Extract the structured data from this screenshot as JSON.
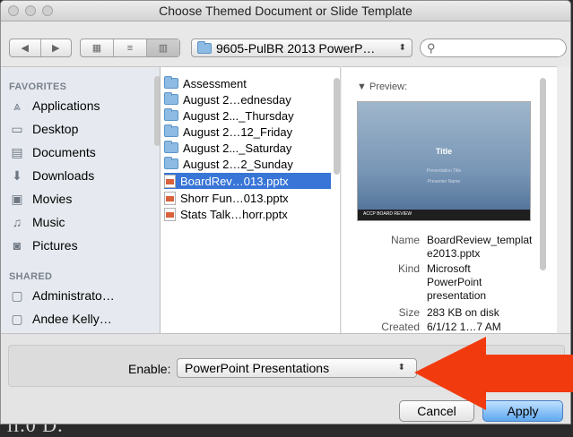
{
  "window": {
    "title": "Choose Themed Document or Slide Template"
  },
  "toolbar": {
    "back": "◀",
    "forward": "▶",
    "path": "9605-PulBR 2013 PowerP…",
    "search_placeholder": ""
  },
  "sidebar": {
    "favorites_header": "FAVORITES",
    "favorites": [
      {
        "label": "Applications",
        "icon": "applications-icon"
      },
      {
        "label": "Desktop",
        "icon": "desktop-icon"
      },
      {
        "label": "Documents",
        "icon": "documents-icon"
      },
      {
        "label": "Downloads",
        "icon": "downloads-icon"
      },
      {
        "label": "Movies",
        "icon": "movies-icon"
      },
      {
        "label": "Music",
        "icon": "music-icon"
      },
      {
        "label": "Pictures",
        "icon": "pictures-icon"
      }
    ],
    "shared_header": "SHARED",
    "shared": [
      {
        "label": "Administrato…",
        "icon": "computer-icon"
      },
      {
        "label": "Andee Kelly…",
        "icon": "computer-icon"
      }
    ]
  },
  "files": [
    {
      "name": "Assessment",
      "type": "folder"
    },
    {
      "name": "August 2…ednesday",
      "type": "folder"
    },
    {
      "name": "August 2..._Thursday",
      "type": "folder"
    },
    {
      "name": "August 2…12_Friday",
      "type": "folder"
    },
    {
      "name": "August 2..._Saturday",
      "type": "folder"
    },
    {
      "name": "August 2…2_Sunday",
      "type": "folder"
    },
    {
      "name": "BoardRev…013.pptx",
      "type": "pptx",
      "selected": true
    },
    {
      "name": "Shorr Fun…013.pptx",
      "type": "pptx"
    },
    {
      "name": "Stats Talk…horr.pptx",
      "type": "pptx"
    }
  ],
  "preview": {
    "label": "▼ Preview:",
    "thumb_title": "Title",
    "thumb_subtitle": "Presentation Title",
    "thumb_presenter": "Presenter Name",
    "thumb_footer": "ACCP BOARD REVIEW",
    "meta": {
      "name_key": "Name",
      "name_value": "BoardReview_template2013.pptx",
      "kind_key": "Kind",
      "kind_value": "Microsoft PowerPoint presentation",
      "size_key": "Size",
      "size_value": "283 KB on disk",
      "created_key": "Created",
      "created_value": "6/1/12 1…7 AM"
    }
  },
  "bottom": {
    "enable_label": "Enable:",
    "enable_value": "PowerPoint Presentations",
    "cancel": "Cancel",
    "apply": "Apply"
  },
  "underlying_text": "ll.0 D."
}
